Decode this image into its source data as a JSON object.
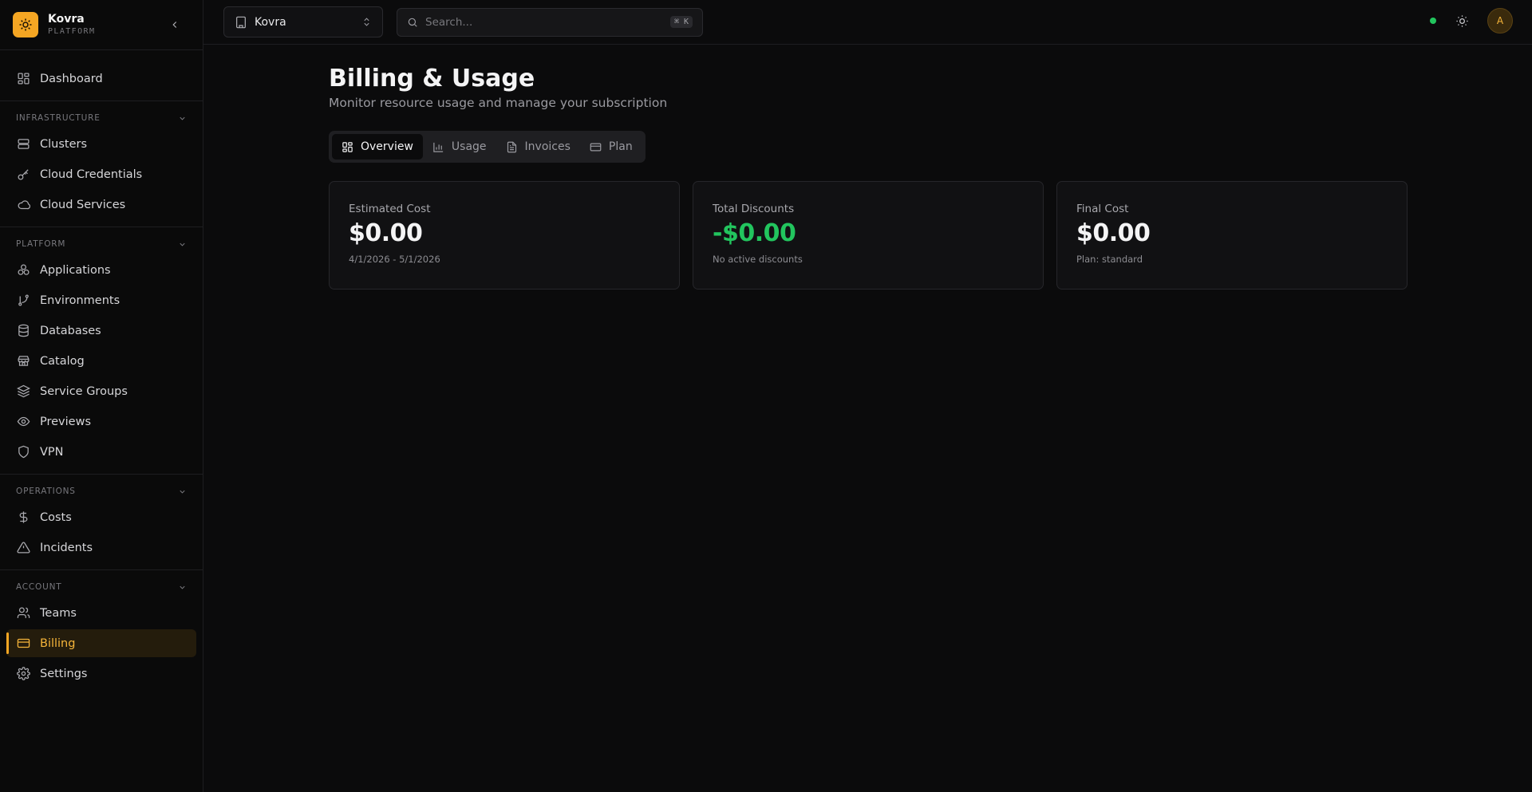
{
  "brand": {
    "name": "Kovra",
    "sub": "PLATFORM",
    "accent": "#f5a623"
  },
  "sidebar": {
    "dashboard": {
      "label": "Dashboard",
      "icon": "dashboard-icon"
    },
    "sections": [
      {
        "title": "INFRASTRUCTURE",
        "items": [
          {
            "label": "Clusters",
            "icon": "server-icon"
          },
          {
            "label": "Cloud Credentials",
            "icon": "key-icon"
          },
          {
            "label": "Cloud Services",
            "icon": "cloud-icon"
          }
        ]
      },
      {
        "title": "PLATFORM",
        "items": [
          {
            "label": "Applications",
            "icon": "boxes-icon"
          },
          {
            "label": "Environments",
            "icon": "git-branch-icon"
          },
          {
            "label": "Databases",
            "icon": "database-icon"
          },
          {
            "label": "Catalog",
            "icon": "store-icon"
          },
          {
            "label": "Service Groups",
            "icon": "layers-icon"
          },
          {
            "label": "Previews",
            "icon": "eye-icon"
          },
          {
            "label": "VPN",
            "icon": "shield-icon"
          }
        ]
      },
      {
        "title": "OPERATIONS",
        "items": [
          {
            "label": "Costs",
            "icon": "dollar-icon"
          },
          {
            "label": "Incidents",
            "icon": "alert-triangle-icon"
          }
        ]
      },
      {
        "title": "ACCOUNT",
        "items": [
          {
            "label": "Teams",
            "icon": "users-icon"
          },
          {
            "label": "Billing",
            "icon": "credit-card-icon",
            "active": true
          },
          {
            "label": "Settings",
            "icon": "gear-icon"
          }
        ]
      }
    ]
  },
  "topbar": {
    "org": "Kovra",
    "search_placeholder": "Search...",
    "shortcut": "⌘ K",
    "avatar": "A",
    "status_color": "#22c55e"
  },
  "page": {
    "title": "Billing & Usage",
    "subtitle": "Monitor resource usage and manage your subscription",
    "tabs": [
      {
        "label": "Overview",
        "icon": "grid-icon",
        "active": true
      },
      {
        "label": "Usage",
        "icon": "bar-chart-icon"
      },
      {
        "label": "Invoices",
        "icon": "file-text-icon"
      },
      {
        "label": "Plan",
        "icon": "credit-card-icon"
      }
    ],
    "cards": [
      {
        "label": "Estimated Cost",
        "value": "$0.00",
        "note": "4/1/2026 - 5/1/2026"
      },
      {
        "label": "Total Discounts",
        "value": "-$0.00",
        "note": "No active discounts",
        "value_color": "#22c55e"
      },
      {
        "label": "Final Cost",
        "value": "$0.00",
        "note": "Plan: standard"
      }
    ]
  }
}
